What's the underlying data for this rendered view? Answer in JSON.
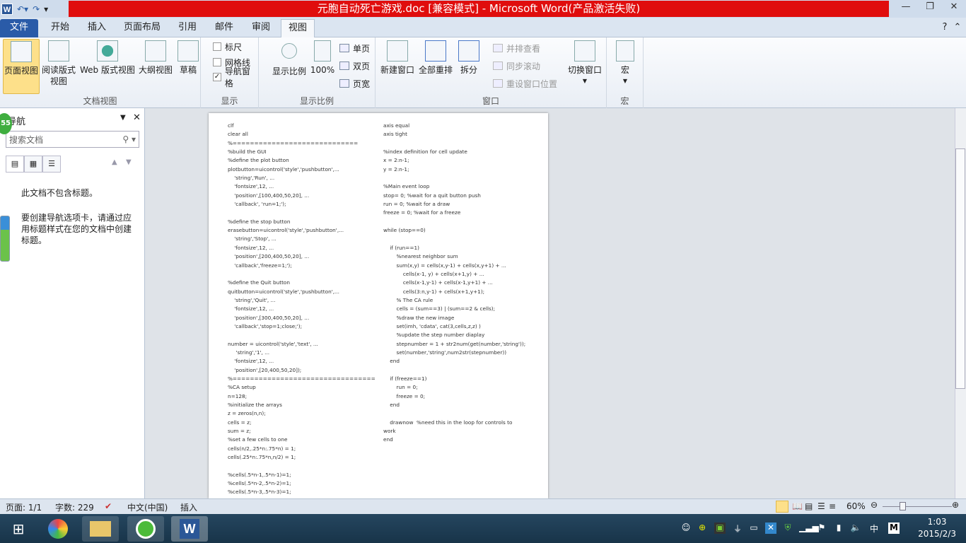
{
  "titlebar": {
    "title": "元胞自动死亡游戏.doc [兼容模式] - Microsoft Word(产品激活失败)",
    "app_icon": "W"
  },
  "tabs": [
    "文件",
    "开始",
    "插入",
    "页面布局",
    "引用",
    "邮件",
    "审阅",
    "视图"
  ],
  "ribbon": {
    "doc_views": {
      "label": "文档视图",
      "buttons": [
        "页面视图",
        "阅读版式\n视图",
        "Web 版式视图",
        "大纲视图",
        "草稿"
      ]
    },
    "show": {
      "label": "显示",
      "checks": [
        {
          "label": "标尺",
          "checked": false
        },
        {
          "label": "网格线",
          "checked": false
        },
        {
          "label": "导航窗格",
          "checked": true
        }
      ]
    },
    "zoom": {
      "label": "显示比例",
      "zoom_btn": "显示比例",
      "hundred": "100%",
      "one_page": "单页",
      "two_pages": "双页",
      "page_width": "页宽"
    },
    "window": {
      "label": "窗口",
      "new_window": "新建窗口",
      "arrange_all": "全部重排",
      "split": "拆分",
      "side_by_side": "并排查看",
      "sync_scroll": "同步滚动",
      "reset_pos": "重设窗口位置",
      "switch": "切换窗口"
    },
    "macros": {
      "label": "宏",
      "btn": "宏"
    }
  },
  "nav": {
    "title": "导航",
    "badge": "55",
    "search_placeholder": "搜索文档",
    "msg1": "此文档不包含标题。",
    "msg2": "要创建导航选项卡，请通过应用标题样式在您的文档中创建标题。"
  },
  "doc": {
    "left": [
      "clf",
      "clear all",
      "%=============================",
      "%build the GUI",
      "%define the plot button",
      "plotbutton=uicontrol('style','pushbutton',...",
      "    'string','Run', ...",
      "    'fontsize',12, ...",
      "    'position',[100,400,50,20], ...",
      "    'callback', 'run=1;');",
      "",
      "%define the stop button",
      "erasebutton=uicontrol('style','pushbutton',...",
      "    'string','Stop', ...",
      "    'fontsize',12, ...",
      "    'position',[200,400,50,20], ...",
      "    'callback','freeze=1;');",
      "",
      "%define the Quit button",
      "quitbutton=uicontrol('style','pushbutton',...",
      "    'string','Quit', ...",
      "    'fontsize',12, ...",
      "    'position',[300,400,50,20], ...",
      "    'callback','stop=1;close;');",
      "",
      "number = uicontrol('style','text', ...",
      "     'string','1', ...",
      "    'fontsize',12, ...",
      "    'position',[20,400,50,20]);",
      "%=================================",
      "%CA setup",
      "n=128;",
      "%initialize the arrays",
      "z = zeros(n,n);",
      "cells = z;",
      "sum = z;",
      "%set a few cells to one",
      "cells(n/2,.25*n:.75*n) = 1;",
      "cells(.25*n:.75*n,n/2) = 1;",
      "",
      "%cells(.5*n-1,.5*n-1)=1;",
      "%cells(.5*n-2,.5*n-2)=1;",
      "%cells(.5*n-3,.5*n-3)=1;"
    ],
    "right": [
      "axis equal",
      "axis tight",
      "",
      "%index definition for cell update",
      "x = 2:n-1;",
      "y = 2:n-1;",
      "",
      "%Main event loop",
      "stop= 0; %wait for a quit button push",
      "run = 0; %wait for a draw",
      "freeze = 0; %wait for a freeze",
      "",
      "while (stop==0)",
      "    ",
      "    if (run==1)",
      "        %nearest neighbor sum",
      "        sum(x,y) = cells(x,y-1) + cells(x,y+1) + ...",
      "            cells(x-1, y) + cells(x+1,y) + ...",
      "            cells(x-1,y-1) + cells(x-1,y+1) + ...",
      "            cells(3:n,y-1) + cells(x+1,y+1);",
      "        % The CA rule",
      "        cells = (sum==3) | (sum==2 & cells);",
      "        %draw the new image",
      "        set(imh, 'cdata', cat(3,cells,z,z) )",
      "        %update the step number diaplay",
      "        stepnumber = 1 + str2num(get(number,'string'));",
      "        set(number,'string',num2str(stepnumber))",
      "    end",
      "    ",
      "    if (freeze==1)",
      "        run = 0;",
      "        freeze = 0;",
      "    end",
      "    ",
      "    drawnow  %need this in the loop for controls to",
      "work",
      "end"
    ]
  },
  "status": {
    "page": "页面: 1/1",
    "words": "字数: 229",
    "lang": "中文(中国)",
    "mode": "插入",
    "zoom": "60%"
  },
  "taskbar": {
    "time": "1:03",
    "date": "2015/2/3",
    "ime": "中",
    "m": "M"
  },
  "colors": {
    "title_red": "#e00d0d",
    "file_tab": "#2a5ba8",
    "taskbar": "#1f3e55"
  }
}
